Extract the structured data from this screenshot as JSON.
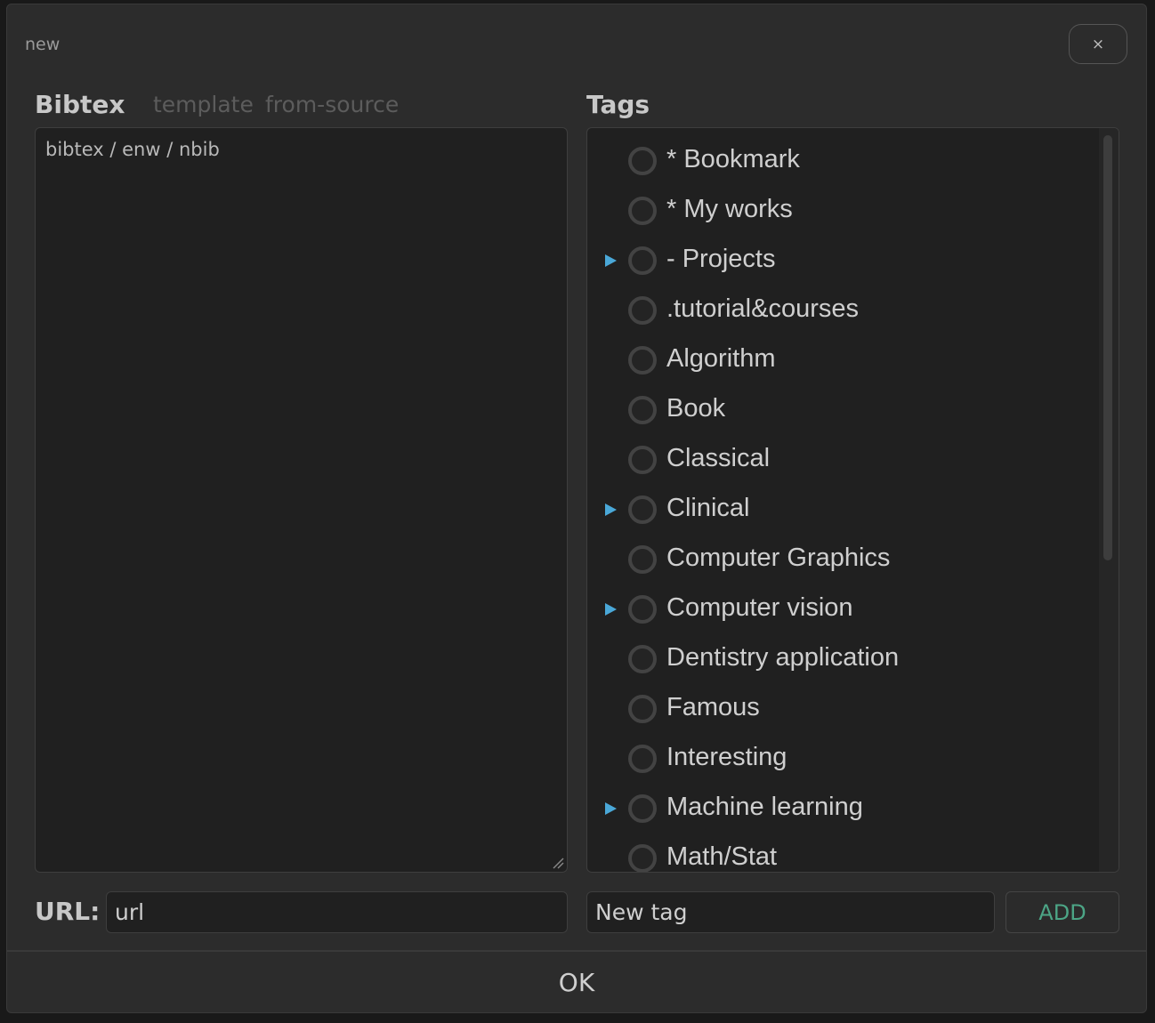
{
  "dialog": {
    "title": "new",
    "close_label": "×"
  },
  "bibtex": {
    "heading": "Bibtex",
    "tabs": [
      "template",
      "from-source"
    ],
    "placeholder": "bibtex / enw / nbib"
  },
  "tags": {
    "heading": "Tags",
    "items": [
      {
        "label": "* Bookmark",
        "expandable": false
      },
      {
        "label": "* My works",
        "expandable": false
      },
      {
        "label": "- Projects",
        "expandable": true
      },
      {
        "label": ".tutorial&courses",
        "expandable": false
      },
      {
        "label": "Algorithm",
        "expandable": false
      },
      {
        "label": "Book",
        "expandable": false
      },
      {
        "label": "Classical",
        "expandable": false
      },
      {
        "label": "Clinical",
        "expandable": true
      },
      {
        "label": "Computer Graphics",
        "expandable": false
      },
      {
        "label": "Computer vision",
        "expandable": true
      },
      {
        "label": "Dentistry application",
        "expandable": false
      },
      {
        "label": "Famous",
        "expandable": false
      },
      {
        "label": "Interesting",
        "expandable": false
      },
      {
        "label": "Machine learning",
        "expandable": true
      },
      {
        "label": "Math/Stat",
        "expandable": false
      }
    ]
  },
  "url": {
    "label": "URL:",
    "placeholder": "url"
  },
  "new_tag": {
    "placeholder": "New tag",
    "add_label": "ADD"
  },
  "footer": {
    "ok_label": "OK"
  },
  "colors": {
    "accent_arrow": "#4aa8d8",
    "add_text": "#4ca586",
    "background": "#2c2c2c",
    "field_background": "#202020"
  }
}
